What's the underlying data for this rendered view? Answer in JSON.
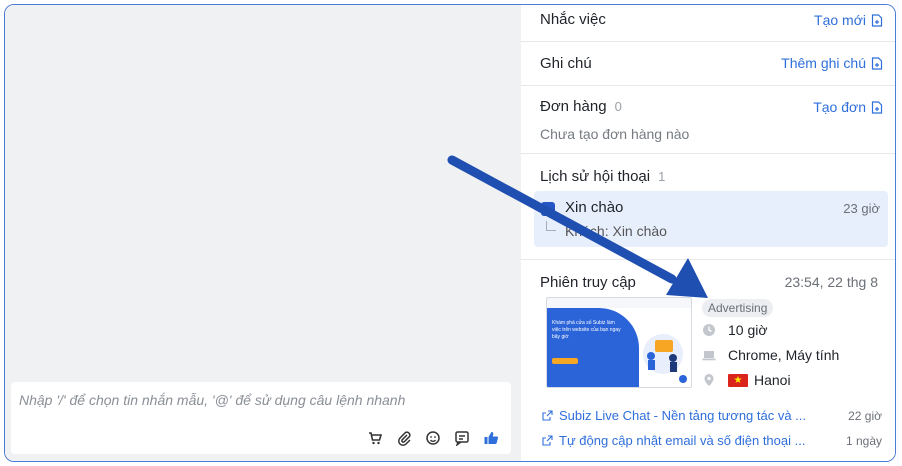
{
  "composer": {
    "placeholder": "Nhập '/' để chọn tin nhắn mẫu, '@' để sử dụng câu lệnh nhanh",
    "tools": [
      "cart-icon",
      "attachment-icon",
      "emoji-icon",
      "template-icon",
      "like-icon"
    ]
  },
  "sidebar": {
    "reminder": {
      "title": "Nhắc việc",
      "action": "Tạo mới"
    },
    "note": {
      "title": "Ghi chú",
      "action": "Thêm ghi chú"
    },
    "orders": {
      "title": "Đơn hàng",
      "count": "0",
      "action": "Tạo đơn",
      "empty": "Chưa tạo đơn hàng nào"
    },
    "history": {
      "title": "Lịch sử hội thoại",
      "count": "1",
      "item": {
        "title": "Xin chào",
        "preview": "Khách: Xin chào",
        "time": "23 giờ"
      }
    },
    "session": {
      "title": "Phiên truy cập",
      "time": "23:54, 22 thg 8",
      "badge": "Advertising",
      "duration": "10 giờ",
      "device": "Chrome, Máy tính",
      "location": "Hanoi",
      "thumb_text": "Khám phá cửa số Subiz làm việc trên website của bạn ngay bây giờ"
    },
    "visits": [
      {
        "title": "Subiz Live Chat - Nền tảng tương tác và ...",
        "ago": "22 giờ"
      },
      {
        "title": "Tự động cập nhật email và số điện thoại ...",
        "ago": "1 ngày"
      }
    ]
  },
  "colors": {
    "accent": "#2f6fdb",
    "arrow": "#1f4fb0",
    "frame": "#4a7bd6"
  }
}
